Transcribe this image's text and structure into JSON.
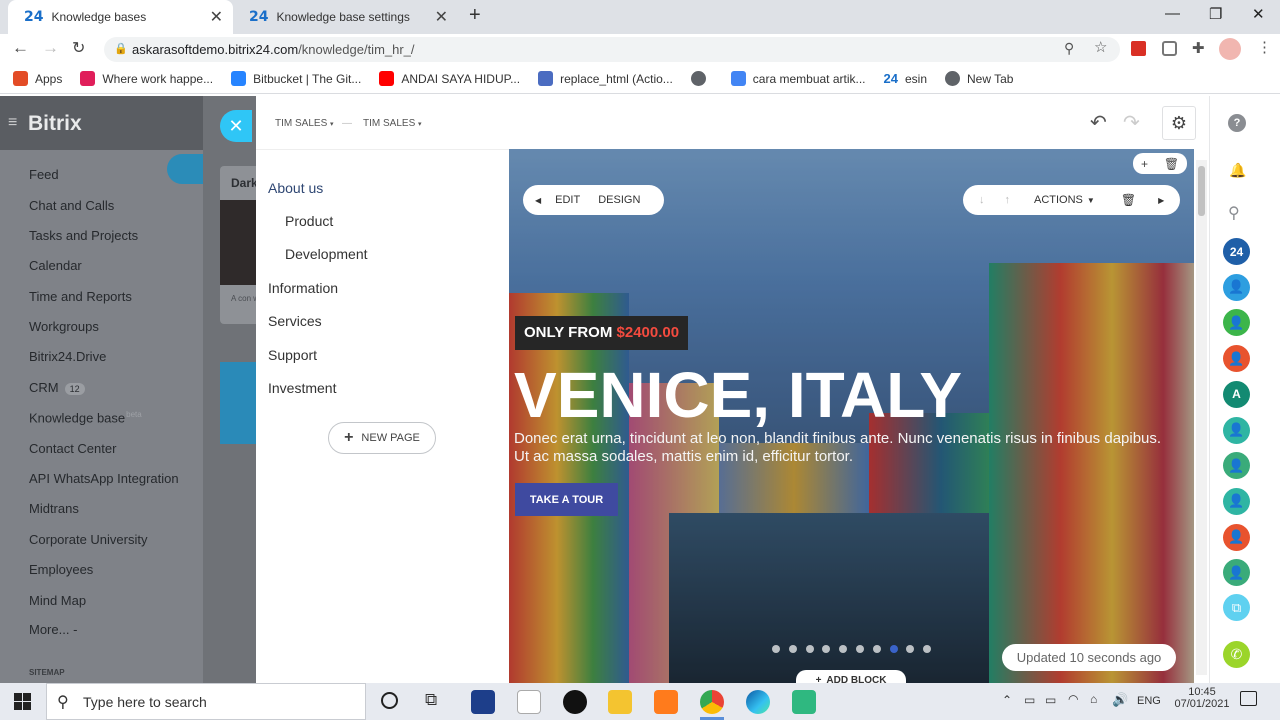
{
  "browser": {
    "tabs": [
      {
        "icon": "24",
        "label": "Knowledge bases"
      },
      {
        "icon": "24",
        "label": "Knowledge base settings"
      }
    ],
    "url_host": "askarasoftdemo.bitrix24.com",
    "url_path": "/knowledge/tim_hr_/",
    "bookmarks": [
      {
        "label": "Apps",
        "color": "#e34c26"
      },
      {
        "label": "Where work happe...",
        "color": "#e01e5a"
      },
      {
        "label": "Bitbucket | The Git...",
        "color": "#2684ff"
      },
      {
        "label": "ANDAI SAYA HIDUP...",
        "color": "#ff0000"
      },
      {
        "label": "replace_html (Actio...",
        "color": "#4b6cc1"
      },
      {
        "label": "cara membuat artik...",
        "color": "#4285f4"
      },
      {
        "label": "esin",
        "color": "#1a6fc9"
      },
      {
        "label": "New Tab",
        "color": "#5f6368"
      }
    ]
  },
  "sidebar": {
    "logo": "Bitrix",
    "items": [
      {
        "label": "Feed"
      },
      {
        "label": "Chat and Calls"
      },
      {
        "label": "Tasks and Projects"
      },
      {
        "label": "Calendar"
      },
      {
        "label": "Time and Reports"
      },
      {
        "label": "Workgroups"
      },
      {
        "label": "Bitrix24.Drive"
      },
      {
        "label": "CRM",
        "badge": "12"
      },
      {
        "label": "Knowledge base",
        "sup": "beta"
      },
      {
        "label": "Contact Center"
      },
      {
        "label": "API WhatsApp Integration"
      },
      {
        "label": "Midtrans"
      },
      {
        "label": "Corporate University"
      },
      {
        "label": "Employees"
      },
      {
        "label": "Mind Map"
      },
      {
        "label": "More... -"
      }
    ],
    "sitemap": "SITEMAP",
    "behind_card_title": "Dark",
    "behind_card_text": "A con with a"
  },
  "editor": {
    "breadcrumb": [
      "TIM SALES",
      "TIM SALES"
    ],
    "breadcrumb_sep": "—",
    "pages": [
      {
        "label": "About us",
        "sub": false
      },
      {
        "label": "Product",
        "sub": true
      },
      {
        "label": "Development",
        "sub": true
      },
      {
        "label": "Information",
        "sub": false
      },
      {
        "label": "Services",
        "sub": false
      },
      {
        "label": "Support",
        "sub": false
      },
      {
        "label": "Investment",
        "sub": false
      }
    ],
    "new_page": "NEW PAGE",
    "toolbar_left": {
      "edit": "EDIT",
      "design": "DESIGN"
    },
    "toolbar_right": {
      "actions": "ACTIONS"
    },
    "hero": {
      "price_prefix": "ONLY FROM",
      "price": "$2400.00",
      "title": "VENICE, ITALY",
      "description": "Donec erat urna, tincidunt at leo non, blandit finibus ante. Nunc venenatis risus in finibus dapibus. Ut ac massa sodales, mattis enim id, efficitur tortor.",
      "cta": "TAKE A TOUR",
      "slide_count": 10,
      "active_slide": 8
    },
    "updated": "Updated 10 seconds ago",
    "add_block": "ADD BLOCK"
  },
  "rail": {
    "avatars": [
      {
        "label": "24",
        "color": "#1f5fa8"
      },
      {
        "label": "",
        "color": "#2d9ee0"
      },
      {
        "label": "",
        "color": "#3cb54a"
      },
      {
        "label": "",
        "color": "#e8532e"
      },
      {
        "label": "A",
        "color": "#138a72"
      },
      {
        "label": "",
        "color": "#2fb5a3"
      },
      {
        "label": "",
        "color": "#3aab7a"
      },
      {
        "label": "",
        "color": "#2fb5a3"
      },
      {
        "label": "",
        "color": "#e8532e"
      },
      {
        "label": "",
        "color": "#3aab7a"
      }
    ]
  },
  "taskbar": {
    "search_placeholder": "Type here to search",
    "lang": "ENG",
    "time": "10:45",
    "date": "07/01/2021"
  }
}
